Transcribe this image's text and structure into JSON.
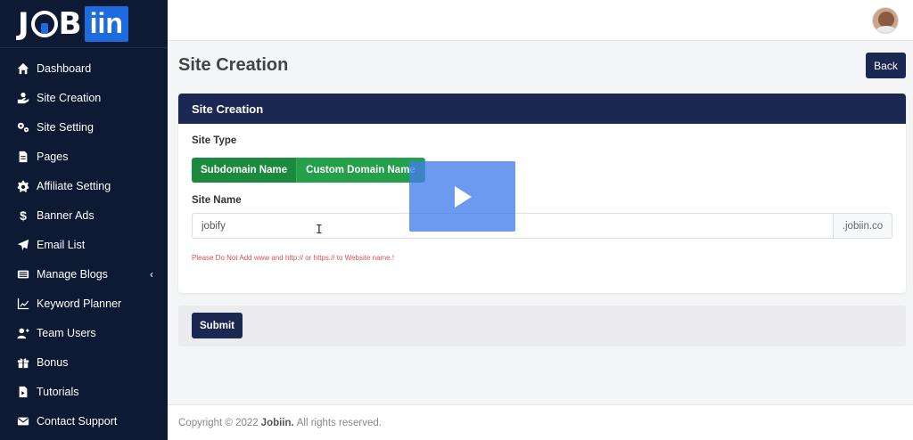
{
  "app": {
    "logo_text": "JOBiin"
  },
  "sidebar": {
    "items": [
      {
        "label": "Dashboard",
        "icon": "home-icon"
      },
      {
        "label": "Site Creation",
        "icon": "hand-icon"
      },
      {
        "label": "Site Setting",
        "icon": "gears-icon"
      },
      {
        "label": "Pages",
        "icon": "page-icon"
      },
      {
        "label": "Affiliate Setting",
        "icon": "gear-icon"
      },
      {
        "label": "Banner Ads",
        "icon": "dollar-icon"
      },
      {
        "label": "Email List",
        "icon": "paper-plane-icon"
      },
      {
        "label": "Manage Blogs",
        "icon": "list-icon",
        "chevron": "‹"
      },
      {
        "label": "Keyword Planner",
        "icon": "chart-icon"
      },
      {
        "label": "Team Users",
        "icon": "user-plus-icon"
      },
      {
        "label": "Bonus",
        "icon": "gift-icon"
      },
      {
        "label": "Tutorials",
        "icon": "file-icon"
      },
      {
        "label": "Contact Support",
        "icon": "envelope-icon"
      }
    ]
  },
  "header": {
    "title": "Site Creation",
    "back_label": "Back"
  },
  "card": {
    "title": "Site Creation",
    "site_type_label": "Site Type",
    "type_options": [
      "Subdomain Name",
      "Custom Domain Name"
    ],
    "site_name_label": "Site Name",
    "site_name_value": "jobify",
    "domain_suffix": ".jobiin.co",
    "warning": "Please Do Not Add www and http:// or https:// to Website name.!"
  },
  "submit_label": "Submit",
  "footer": {
    "prefix": "Copyright © 2022",
    "brand": "Jobiin.",
    "suffix": "All rights reserved."
  },
  "colors": {
    "sidebar_bg": "#0e1a33",
    "primary": "#1b2852",
    "success": "#1c8a3e",
    "brand_blue": "#1e6be0",
    "warning_text": "#d9534f"
  }
}
